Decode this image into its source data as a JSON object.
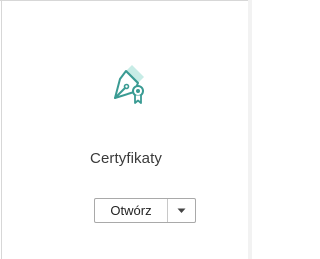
{
  "tool": {
    "label": "Certyfikaty",
    "icon": "pen-nib-certificate-icon",
    "accent_color": "#3a9b93",
    "accent_light_color": "#c7ece6"
  },
  "open_button": {
    "label": "Otwórz",
    "dropdown_icon": "chevron-down-icon"
  }
}
